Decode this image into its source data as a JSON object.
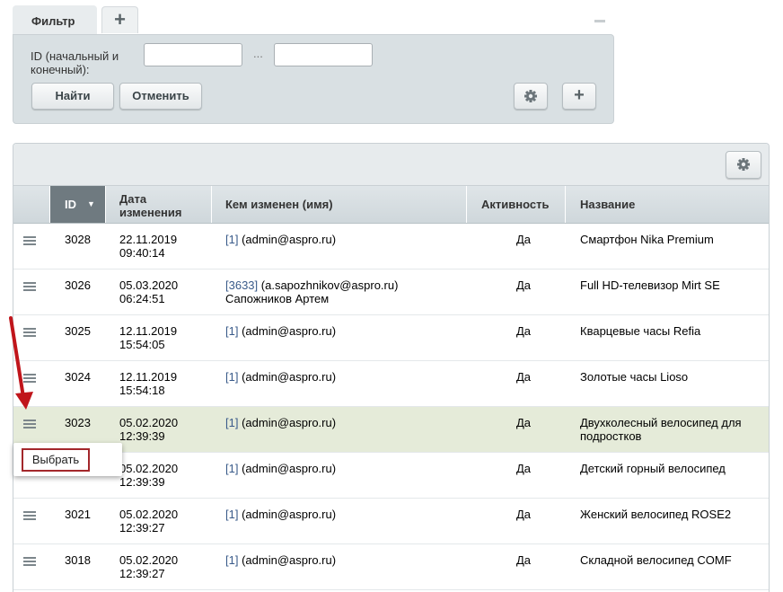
{
  "filter": {
    "tab_label": "Фильтр",
    "add_tab_icon": "plus-icon",
    "id_label": "ID (начальный и конечный):",
    "id_from_value": "",
    "id_to_value": "",
    "range_separator": "...",
    "find_label": "Найти",
    "cancel_label": "Отменить",
    "settings_icon": "gear-icon",
    "add_icon": "plus-icon"
  },
  "grid": {
    "settings_icon": "gear-icon",
    "columns": {
      "id": "ID",
      "date": "Дата изменения",
      "changed_by": "Кем изменен (имя)",
      "active": "Активность",
      "name": "Название"
    },
    "sort_indicator": "▼",
    "rows": [
      {
        "id": "3028",
        "date": "22.11.2019",
        "time": "09:40:14",
        "user_id": "[1]",
        "user": "(admin@aspro.ru)",
        "user_name": "",
        "active": "Да",
        "name": "Смартфон Nika Premium"
      },
      {
        "id": "3026",
        "date": "05.03.2020",
        "time": "06:24:51",
        "user_id": "[3633]",
        "user": "(a.sapozhnikov@aspro.ru)",
        "user_name": "Сапожников Артем",
        "active": "Да",
        "name": "Full HD-телевизор Mirt SE"
      },
      {
        "id": "3025",
        "date": "12.11.2019",
        "time": "15:54:05",
        "user_id": "[1]",
        "user": "(admin@aspro.ru)",
        "user_name": "",
        "active": "Да",
        "name": "Кварцевые часы Refia"
      },
      {
        "id": "3024",
        "date": "12.11.2019",
        "time": "15:54:18",
        "user_id": "[1]",
        "user": "(admin@aspro.ru)",
        "user_name": "",
        "active": "Да",
        "name": "Золотые часы Lioso"
      },
      {
        "id": "3023",
        "date": "05.02.2020",
        "time": "12:39:39",
        "user_id": "[1]",
        "user": "(admin@aspro.ru)",
        "user_name": "",
        "active": "Да",
        "name": "Двухколесный велосипед для подростков"
      },
      {
        "id": "",
        "date": "05.02.2020",
        "time": "12:39:39",
        "user_id": "[1]",
        "user": "(admin@aspro.ru)",
        "user_name": "",
        "active": "Да",
        "name": "Детский горный велосипед"
      },
      {
        "id": "3021",
        "date": "05.02.2020",
        "time": "12:39:27",
        "user_id": "[1]",
        "user": "(admin@aspro.ru)",
        "user_name": "",
        "active": "Да",
        "name": "Женский велосипед ROSE2"
      },
      {
        "id": "3018",
        "date": "05.02.2020",
        "time": "12:39:27",
        "user_id": "[1]",
        "user": "(admin@aspro.ru)",
        "user_name": "",
        "active": "Да",
        "name": "Складной велосипед COMF"
      }
    ]
  },
  "context_menu": {
    "select_label": "Выбрать"
  },
  "colors": {
    "highlight_row": "#e5ebd9",
    "sorted_header": "#6f7a80",
    "annotation": "#c0151b"
  }
}
